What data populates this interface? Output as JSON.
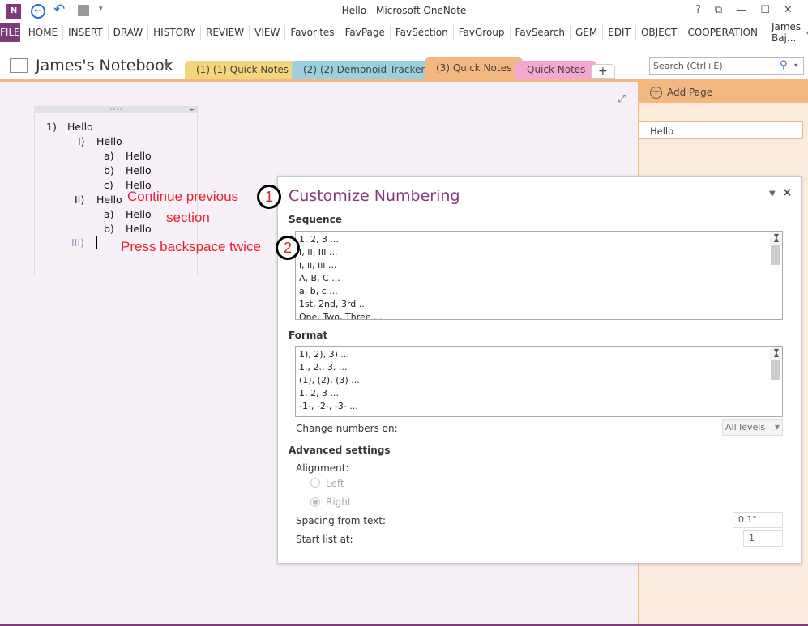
{
  "window": {
    "title": "Hello - Microsoft OneNote",
    "controls": [
      "?",
      "⧉",
      "—",
      "☐",
      "✕"
    ]
  },
  "ribbon": {
    "file": "FILE",
    "tabs": [
      "HOME",
      "INSERT",
      "DRAW",
      "HISTORY",
      "REVIEW",
      "VIEW",
      "Favorites",
      "FavPage",
      "FavSection",
      "FavGroup",
      "FavSearch",
      "GEM",
      "EDIT",
      "OBJECT",
      "COOPERATION"
    ],
    "user": "James Baj..."
  },
  "notebook": {
    "name": "James's Notebook",
    "sections": [
      {
        "label": "(1) (1) Quick Notes",
        "color": "#f5d57a"
      },
      {
        "label": "(2) (2) Demonoid Tracker",
        "color": "#9bd0e0"
      },
      {
        "label": "(3) Quick Notes",
        "color": "#f2b880"
      },
      {
        "label": "Quick Notes",
        "color": "#f3a8d2"
      }
    ],
    "add_section": "+"
  },
  "search": {
    "placeholder": "Search (Ctrl+E)"
  },
  "pages": {
    "add_page": "Add Page",
    "items": [
      "Hello"
    ]
  },
  "note": {
    "lines": [
      {
        "num": "1)",
        "text": "Hello"
      },
      {
        "num": "I)",
        "text": "Hello"
      },
      {
        "num": "a)",
        "text": "Hello"
      },
      {
        "num": "b)",
        "text": "Hello"
      },
      {
        "num": "c)",
        "text": "Hello"
      },
      {
        "num": "II)",
        "text": "Hello"
      },
      {
        "num": "a)",
        "text": "Hello"
      },
      {
        "num": "b)",
        "text": "Hello"
      },
      {
        "num": "III)",
        "text": ""
      }
    ]
  },
  "annotations": {
    "a1_line1": "Continue previous",
    "a1_line2": "section",
    "a1_num": "1",
    "a2": "Press backspace twice",
    "a2_num": "2"
  },
  "dialog": {
    "title": "Customize Numbering",
    "sequence_label": "Sequence",
    "sequence": [
      "1, 2, 3 ...",
      "I, II, III ...",
      "i, ii, iii ...",
      "A, B, C ...",
      "a, b, c ...",
      "1st, 2nd, 3rd ...",
      "One, Two, Three ..."
    ],
    "format_label": "Format",
    "format": [
      "1), 2), 3) ...",
      "1., 2., 3. ...",
      "(1), (2), (3) ...",
      "1, 2, 3 ...",
      "-1-, -2-, -3- ..."
    ],
    "change_numbers_on": "Change numbers on:",
    "change_value": "All levels",
    "advanced": "Advanced settings",
    "alignment": "Alignment:",
    "left": "Left",
    "right": "Right",
    "alignment_selected": "Right",
    "spacing_label": "Spacing from text:",
    "spacing_value": "0.1\"",
    "start_label": "Start list at:",
    "start_value": "1"
  }
}
